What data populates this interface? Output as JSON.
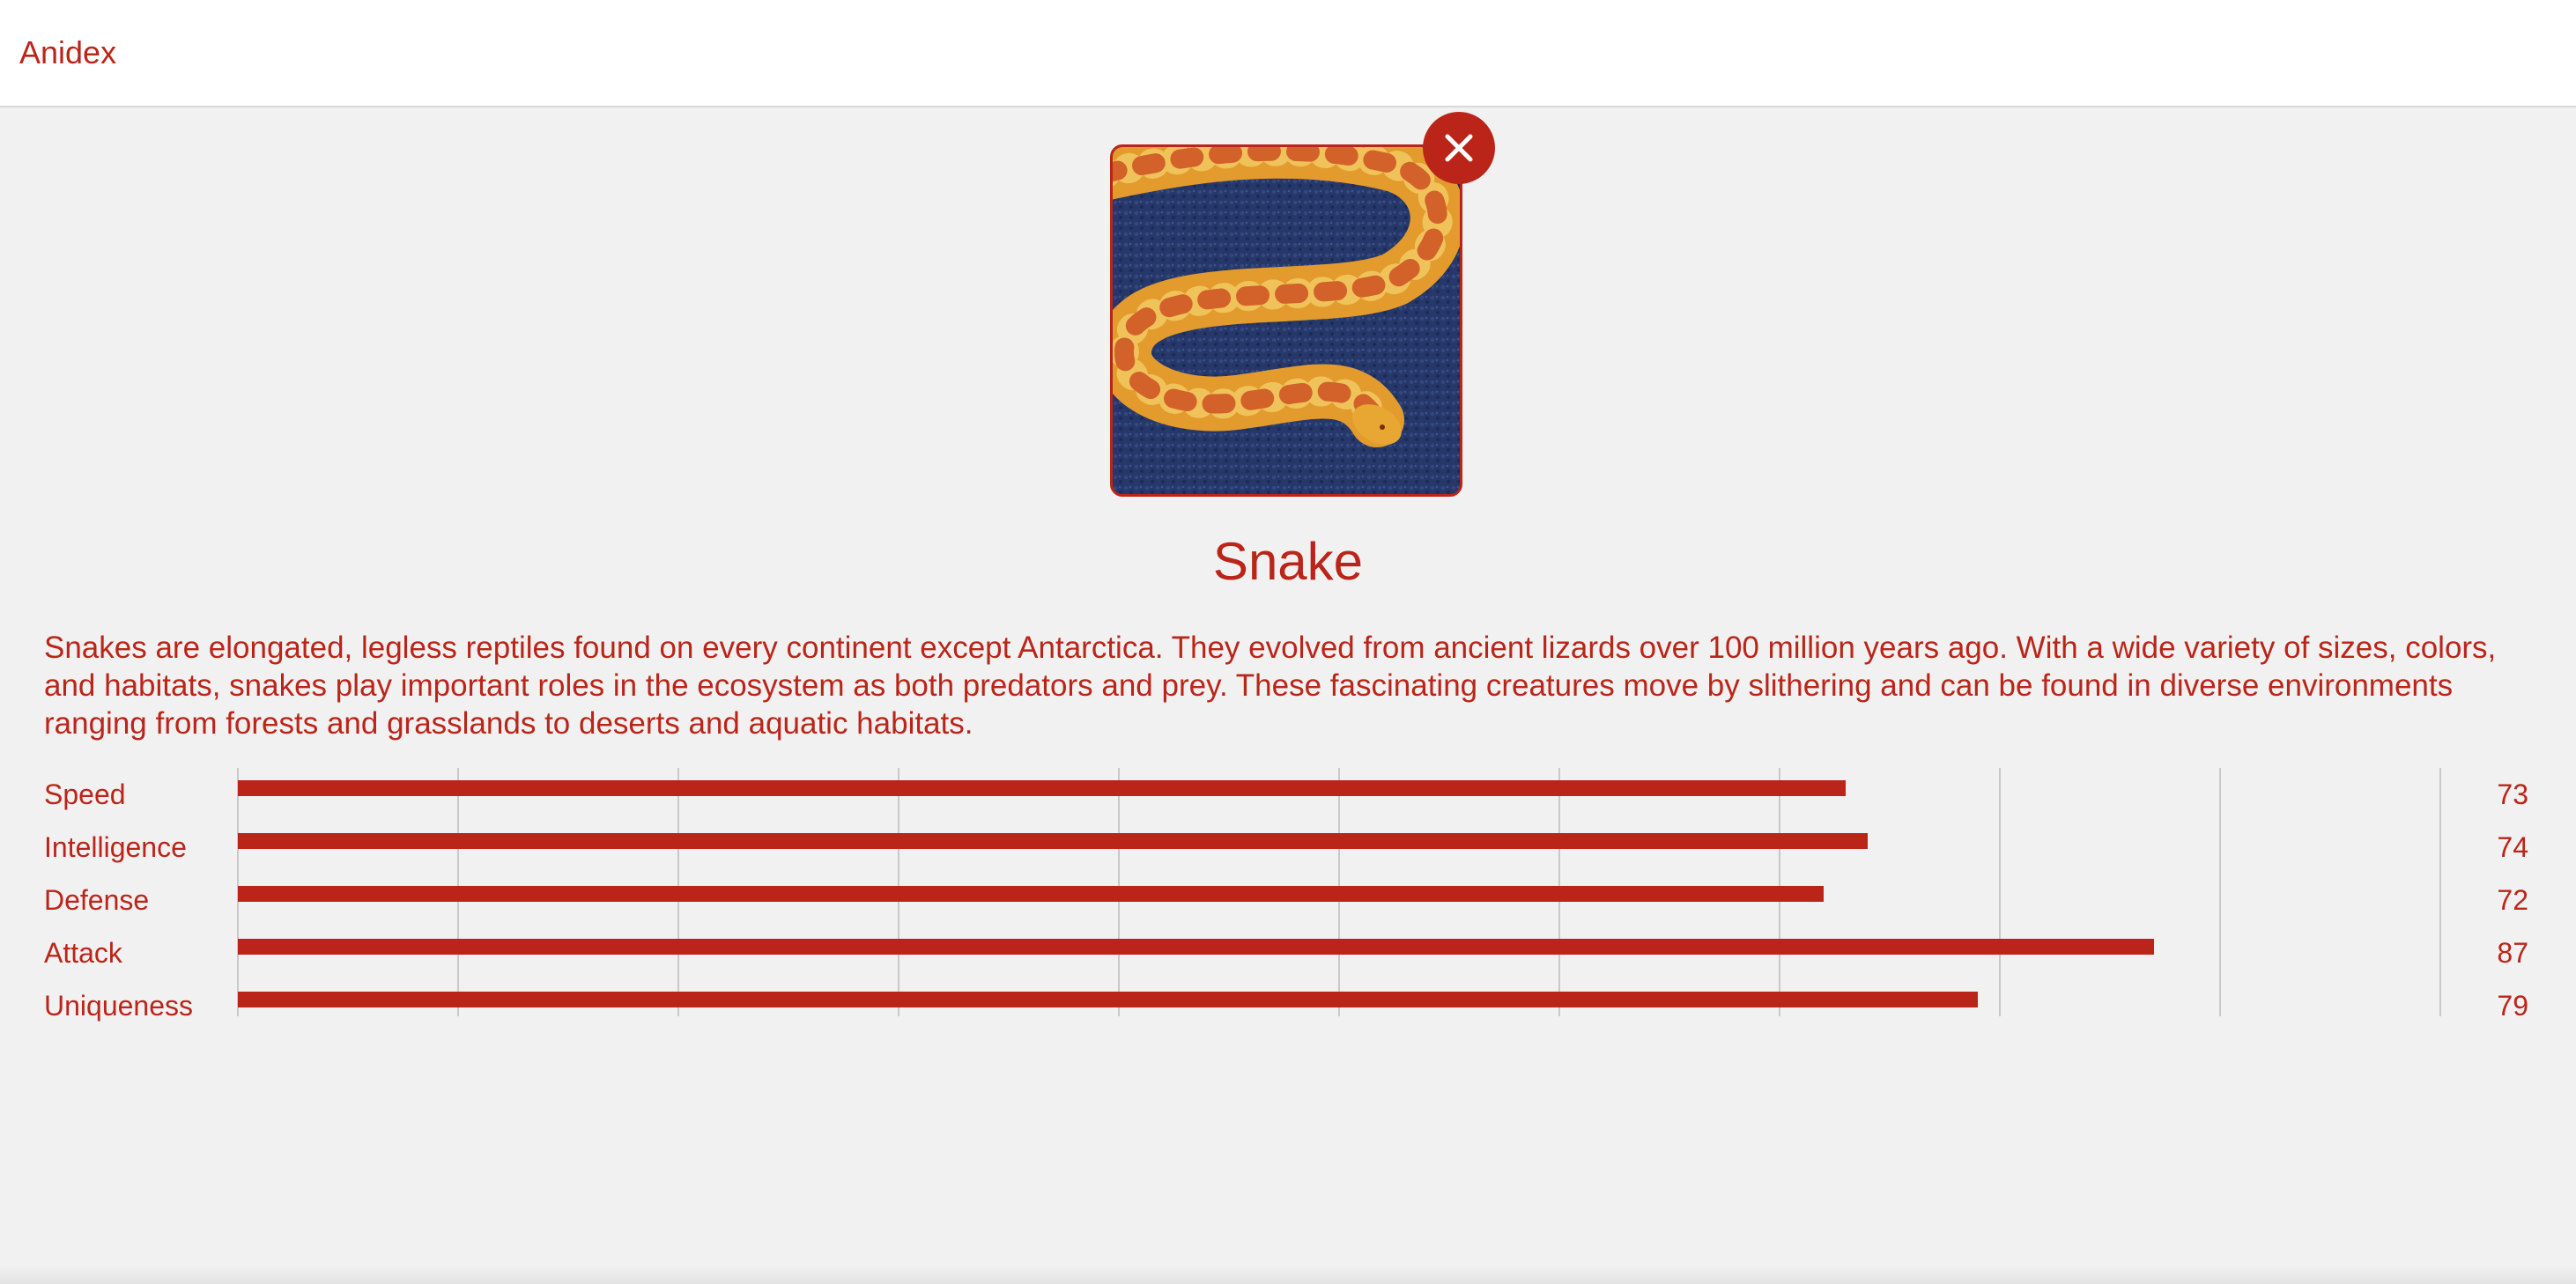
{
  "app": {
    "brand": "Anidex",
    "accent_color": "#bb2519"
  },
  "animal": {
    "name": "Snake",
    "image_icon": "snake-photo",
    "close_icon": "close-icon",
    "description": "Snakes are elongated, legless reptiles found on every continent except Antarctica. They evolved from ancient lizards over 100 million years ago. With a wide variety of sizes, colors, and habitats, snakes play important roles in the ecosystem as both predators and prey. These fascinating creatures move by slithering and can be found in diverse environments ranging from forests and grasslands to deserts and aquatic habitats."
  },
  "stats": {
    "max": 100,
    "items": [
      {
        "label": "Speed",
        "value": 73
      },
      {
        "label": "Intelligence",
        "value": 74
      },
      {
        "label": "Defense",
        "value": 72
      },
      {
        "label": "Attack",
        "value": 87
      },
      {
        "label": "Uniqueness",
        "value": 79
      }
    ]
  }
}
